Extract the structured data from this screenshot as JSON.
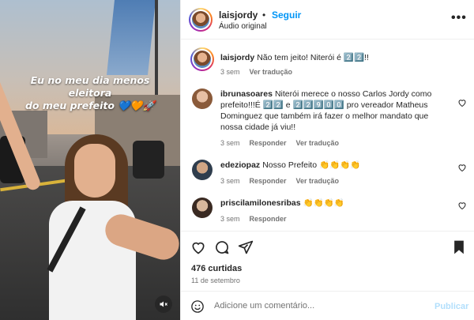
{
  "media": {
    "caption_line1": "Eu no meu dia menos eleitora",
    "caption_line2": "do meu prefeito",
    "caption_emojis": "💙🧡🚀"
  },
  "header": {
    "username": "laisjordy",
    "separator": "•",
    "follow_label": "Seguir",
    "audio": "Áudio original",
    "more": "•••"
  },
  "caption": {
    "username": "laisjordy",
    "text": "Não tem jeito! Niterói é 2️⃣2️⃣!!",
    "time": "3 sem",
    "translate": "Ver tradução"
  },
  "comments": [
    {
      "username": "ibrunasoares",
      "text": "Niterói merece o nosso Carlos Jordy como prefeito!!!É 2️⃣2️⃣ e 2️⃣2️⃣9️⃣0️⃣0️⃣ pro vereador Matheus Dominguez que também irá fazer o melhor mandato que nossa cidade já viu!!",
      "time": "3 sem",
      "reply": "Responder",
      "translate": "Ver tradução"
    },
    {
      "username": "edeziopaz",
      "text": "Nosso Prefeito 👏👏👏👏",
      "time": "3 sem",
      "reply": "Responder",
      "translate": "Ver tradução"
    },
    {
      "username": "priscilamilonesribas",
      "text": "👏👏👏👏",
      "time": "3 sem",
      "reply": "Responder"
    }
  ],
  "likes": "476 curtidas",
  "date": "11 de setembro",
  "add_comment": {
    "placeholder": "Adicione um comentário...",
    "publish_label": "Publicar"
  },
  "colors": {
    "accent": "#0095f6",
    "muted": "#737373",
    "publish_disabled": "#b2dffc"
  }
}
